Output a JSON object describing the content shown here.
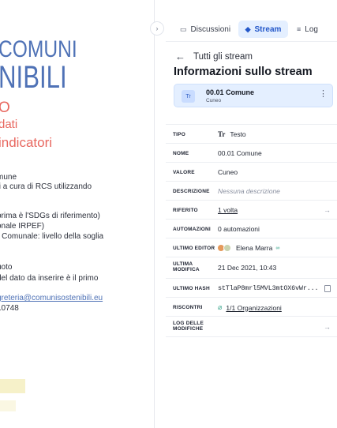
{
  "document": {
    "heading_line1": "COMUNI",
    "heading_line2": "NIBILI",
    "red_line1": "O",
    "red_line2": "dati",
    "red_line3": "indicatori",
    "text_lines": [
      "mune",
      "ti a cura di RCS utilizzando",
      "prima è l'SDGs di riferimento)",
      "onale IRPEF)",
      "² Comunale: livello della soglia",
      "uoto",
      "del dato da inserire è il primo",
      "greteria@comunisostenibili.eu",
      "10748"
    ]
  },
  "tabs": [
    {
      "label": "Discussioni",
      "icon": "chat-icon"
    },
    {
      "label": "Stream",
      "icon": "stream-icon",
      "active": true
    },
    {
      "label": "Log",
      "icon": "list-icon"
    }
  ],
  "back_label": "Tutti gli stream",
  "panel_title": "Informazioni sullo stream",
  "stream_card": {
    "badge": "Tr",
    "name": "00.01 Comune",
    "subtitle": "Cuneo"
  },
  "fields": {
    "tipo": {
      "label": "TIPO",
      "glyph": "Tr",
      "value": "Testo"
    },
    "nome": {
      "label": "NOME",
      "value": "00.01 Comune"
    },
    "valore": {
      "label": "VALORE",
      "value": "Cuneo"
    },
    "descrizione": {
      "label": "DESCRIZIONE",
      "value": "Nessuna descrizione"
    },
    "riferito": {
      "label": "RIFERITO",
      "value": "1 volta"
    },
    "automazioni": {
      "label": "AUTOMAZIONI",
      "value": "0 automazioni"
    },
    "ultimo_editor": {
      "label": "ULTIMO EDITOR",
      "value": "Elena Marra"
    },
    "ultima_modifica": {
      "label_line1": "ULTIMA",
      "label_line2": "MODIFICA",
      "value": "21 Dec 2021, 10:43"
    },
    "ultimo_hash": {
      "label": "ULTIMO HASH",
      "value": "stTlaP8mrl5MVL3mtOX6vWr..."
    },
    "riscontri": {
      "label": "RISCONTRI",
      "value": "1/1 Organizzazioni"
    },
    "log_modifiche": {
      "label_line1": "LOG DELLE",
      "label_line2": "MODIFICHE"
    }
  },
  "colors": {
    "accent": "#2357c9",
    "accent_bg": "#e4efff",
    "doc_blue": "#4f72b6",
    "doc_red": "#e8675f"
  }
}
